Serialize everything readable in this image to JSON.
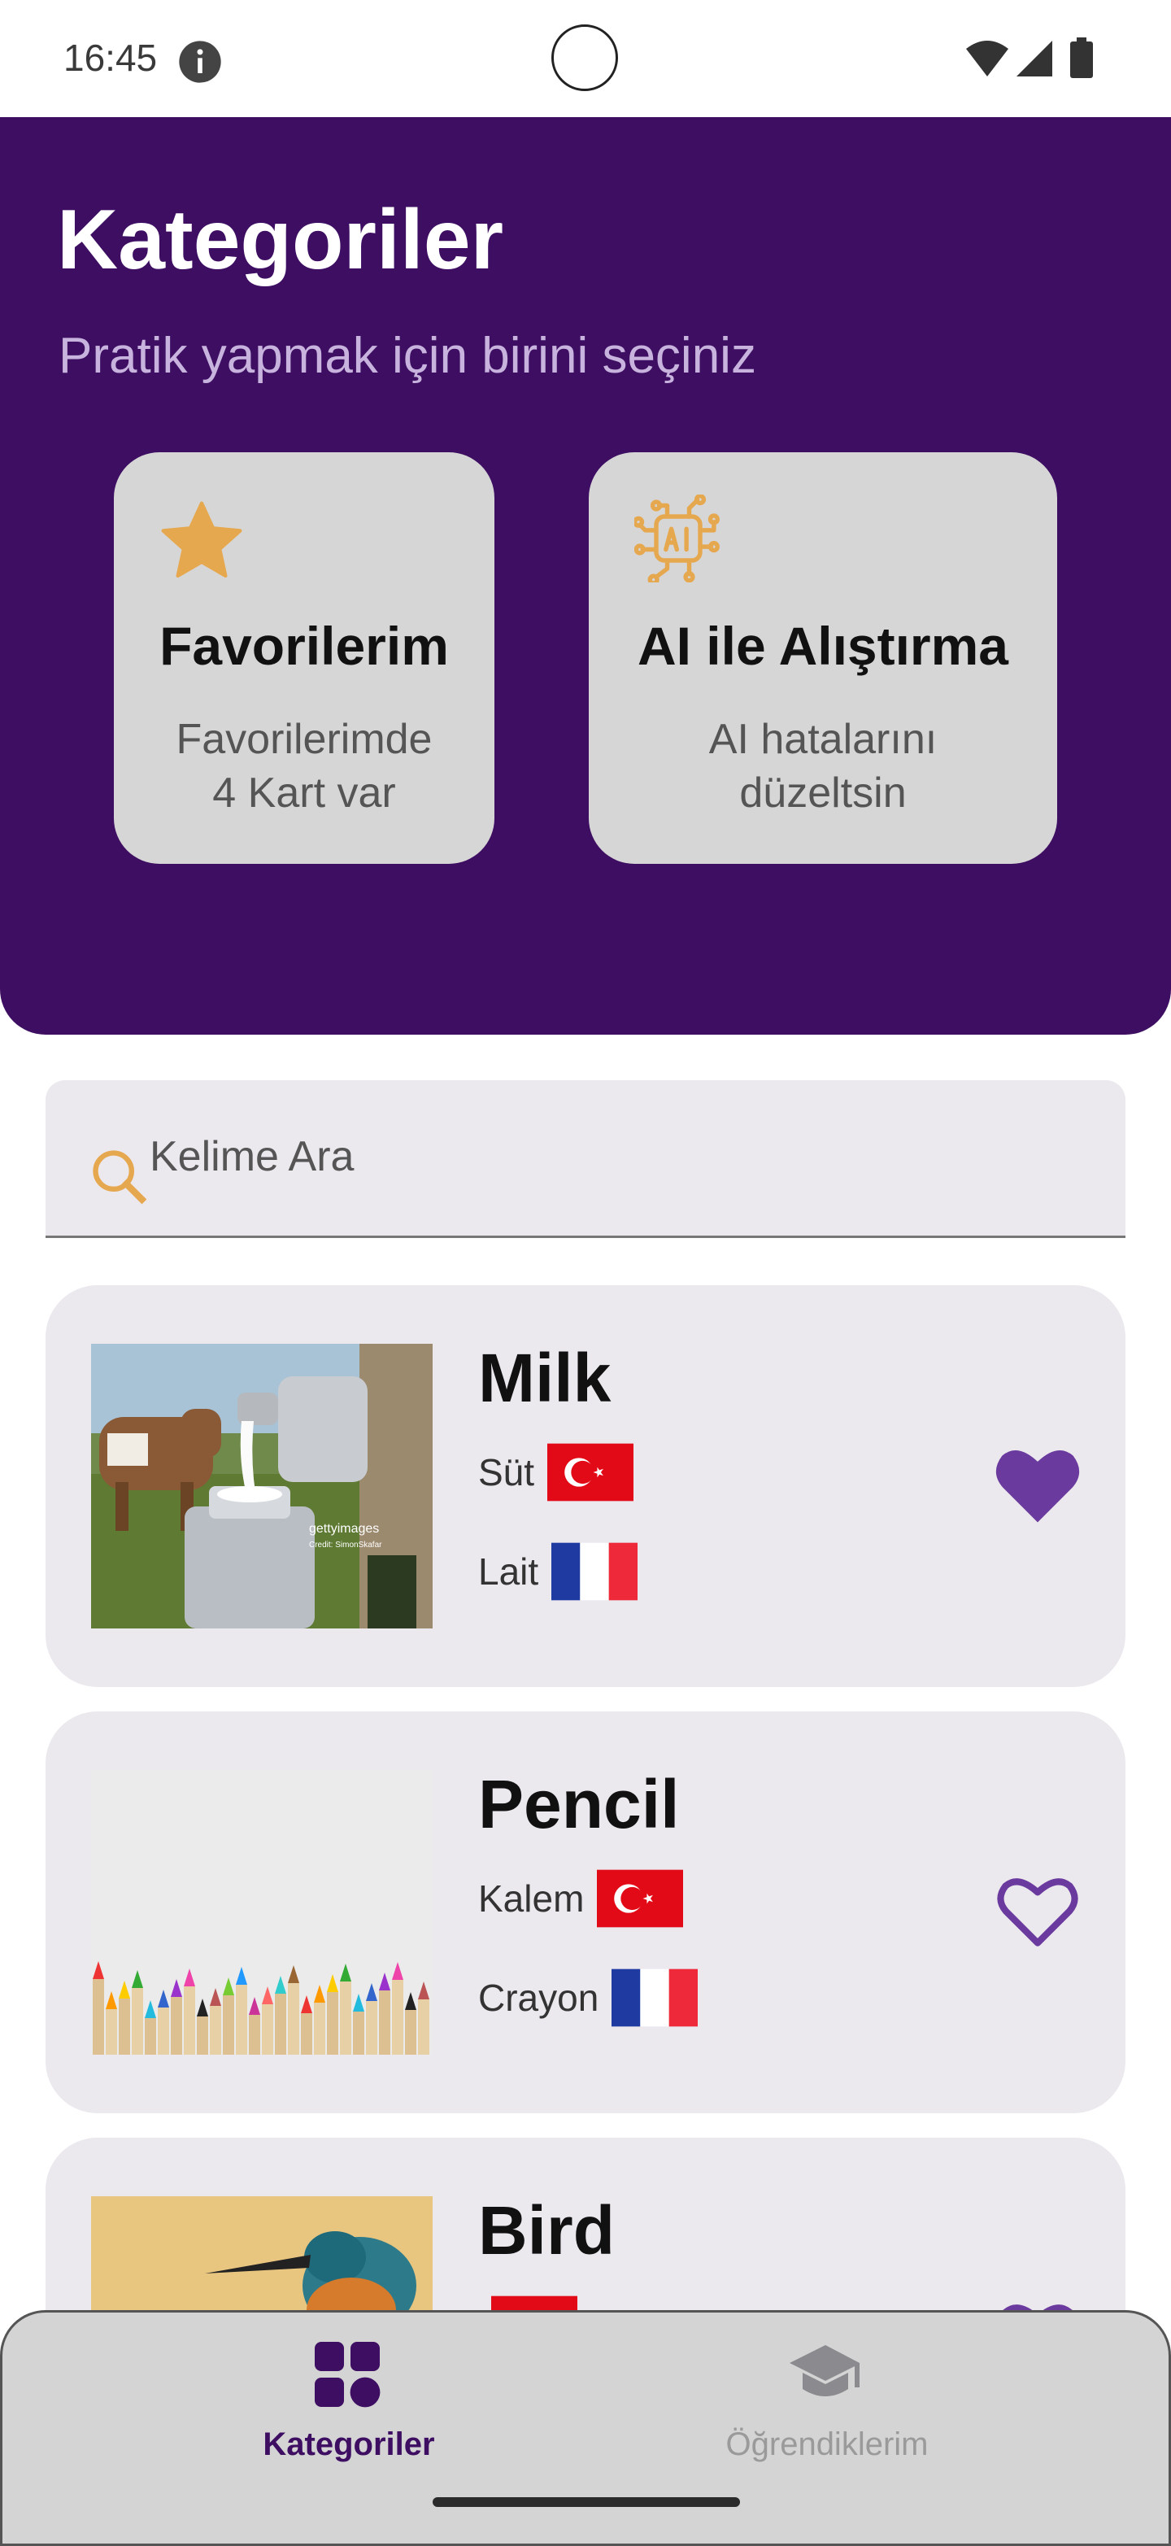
{
  "status_bar": {
    "time": "16:45"
  },
  "header": {
    "title": "Kategoriler",
    "subtitle": "Pratik yapmak için birini seçiniz"
  },
  "feature_cards": [
    {
      "icon": "star-icon",
      "title": "Favorilerim",
      "desc_line1": "Favorilerimde",
      "desc_line2": "4 Kart var"
    },
    {
      "icon": "ai-chip-icon",
      "title": "AI ile Alıştırma",
      "desc_line1": "AI hatalarını",
      "desc_line2": "düzeltsin"
    }
  ],
  "search": {
    "placeholder": "Kelime Ara"
  },
  "words": [
    {
      "title": "Milk",
      "turkish": "Süt",
      "french": "Lait",
      "favorite": true,
      "image": "cow-milk-photo",
      "image_caption": "gettyimages Credit: SimonSkafar"
    },
    {
      "title": "Pencil",
      "turkish": "Kalem",
      "french": "Crayon",
      "favorite": false,
      "image": "colored-pencils-photo"
    },
    {
      "title": "Bird",
      "turkish": "",
      "french": "",
      "favorite": false,
      "image": "kingfisher-photo"
    }
  ],
  "bottom_nav": [
    {
      "icon": "grid-icon",
      "label": "Kategoriler",
      "active": true
    },
    {
      "icon": "graduation-cap-icon",
      "label": "Öğrendiklerim",
      "active": false
    }
  ],
  "colors": {
    "header_bg": "#3d0e62",
    "accent_purple": "#6a3a9e",
    "icon_orange": "#e6a84f",
    "card_bg": "#ebe8ee"
  }
}
